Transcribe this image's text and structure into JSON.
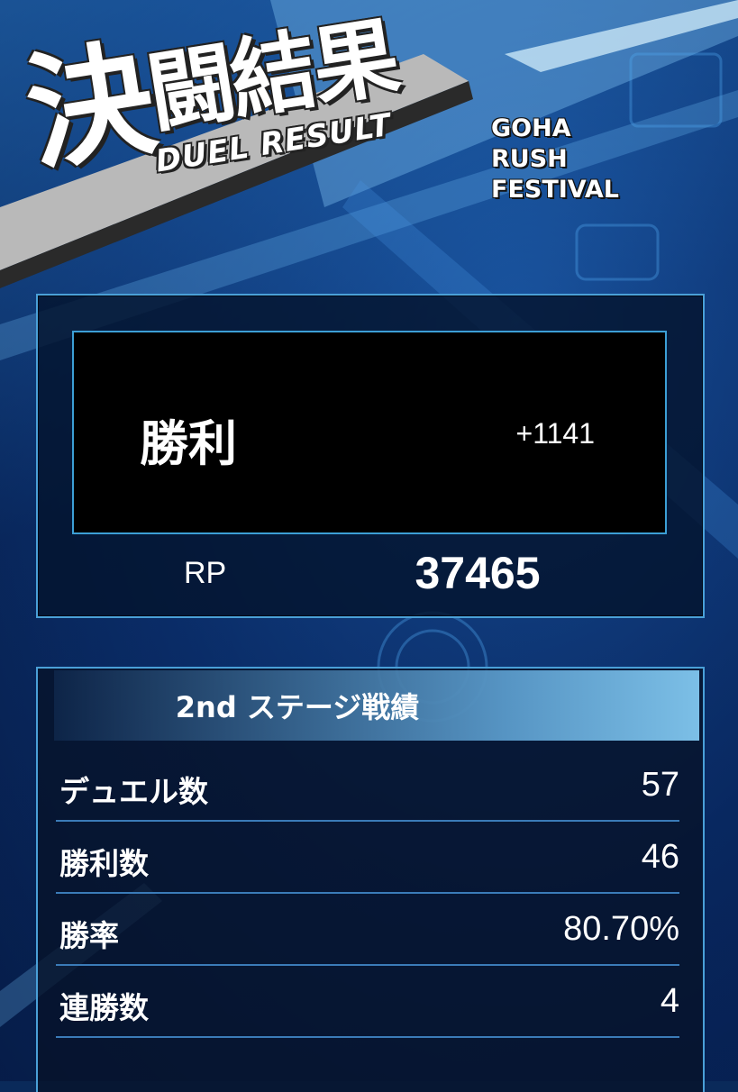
{
  "header": {
    "title_kanji_first": "決",
    "title_kanji_rest": "闘結果",
    "title_en": "DUEL RESULT",
    "event_lines": [
      "GOHA",
      "RUSH",
      "FESTIVAL"
    ]
  },
  "result": {
    "outcome": "勝利",
    "rp_delta": "+1141",
    "rp_label": "RP",
    "rp_value": "37465"
  },
  "stats": {
    "title": "2nd ステージ戦績",
    "rows": [
      {
        "label": "デュエル数",
        "value": "57"
      },
      {
        "label": "勝利数",
        "value": "46"
      },
      {
        "label": "勝率",
        "value": "80.70%"
      },
      {
        "label": "連勝数",
        "value": "4"
      }
    ]
  },
  "colors": {
    "accent": "#4aa0d8",
    "background": "#0a2a5a",
    "text": "#ffffff"
  }
}
